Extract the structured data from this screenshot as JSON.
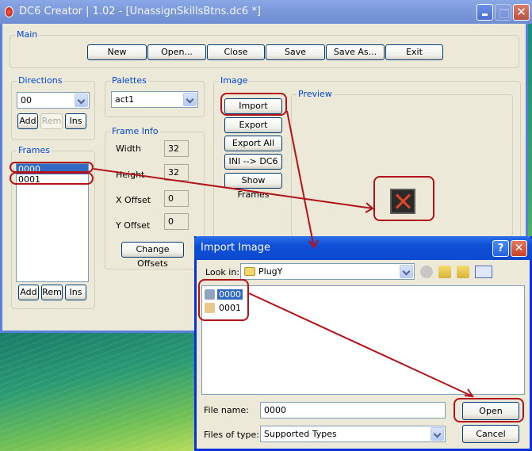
{
  "window": {
    "title": "DC6 Creator  |  1.02 - [UnassignSkillsBtns.dc6 *]",
    "title_buttons": [
      "minimize",
      "maximize",
      "close"
    ]
  },
  "main_group": {
    "label": "Main",
    "buttons": [
      "New",
      "Open...",
      "Close",
      "Save",
      "Save As...",
      "Exit"
    ]
  },
  "directions": {
    "label": "Directions",
    "selected": "00",
    "buttons": [
      "Add",
      "Rem",
      "Ins"
    ],
    "disabled": [
      "Rem"
    ]
  },
  "palettes": {
    "label": "Palettes",
    "selected": "act1"
  },
  "frames": {
    "label": "Frames",
    "items": [
      "0000",
      "0001"
    ],
    "selected_index": 0,
    "buttons": [
      "Add",
      "Rem",
      "Ins"
    ]
  },
  "frame_info": {
    "label": "Frame Info",
    "fields": [
      {
        "label": "Width",
        "value": "32"
      },
      {
        "label": "Height",
        "value": "32"
      },
      {
        "label": "X Offset",
        "value": "0"
      },
      {
        "label": "Y Offset",
        "value": "0"
      }
    ],
    "change_button": "Change Offsets"
  },
  "image_group": {
    "label": "Image",
    "buttons": [
      "Import",
      "Export",
      "Export All",
      "INI --> DC6",
      "Show Frames"
    ],
    "preview_label": "Preview"
  },
  "import_dialog": {
    "title": "Import Image",
    "look_in_label": "Look in:",
    "look_in_value": "PlugY",
    "files": [
      {
        "name": "0000",
        "selected": true
      },
      {
        "name": "0001",
        "selected": false
      }
    ],
    "file_name_label": "File name:",
    "file_name_value": "0000",
    "file_type_label": "Files of type:",
    "file_type_value": "Supported Types",
    "open_button": "Open",
    "cancel_button": "Cancel",
    "help_glyph": "?",
    "close_glyph": "✕"
  },
  "annotation_color": "#b3121b"
}
